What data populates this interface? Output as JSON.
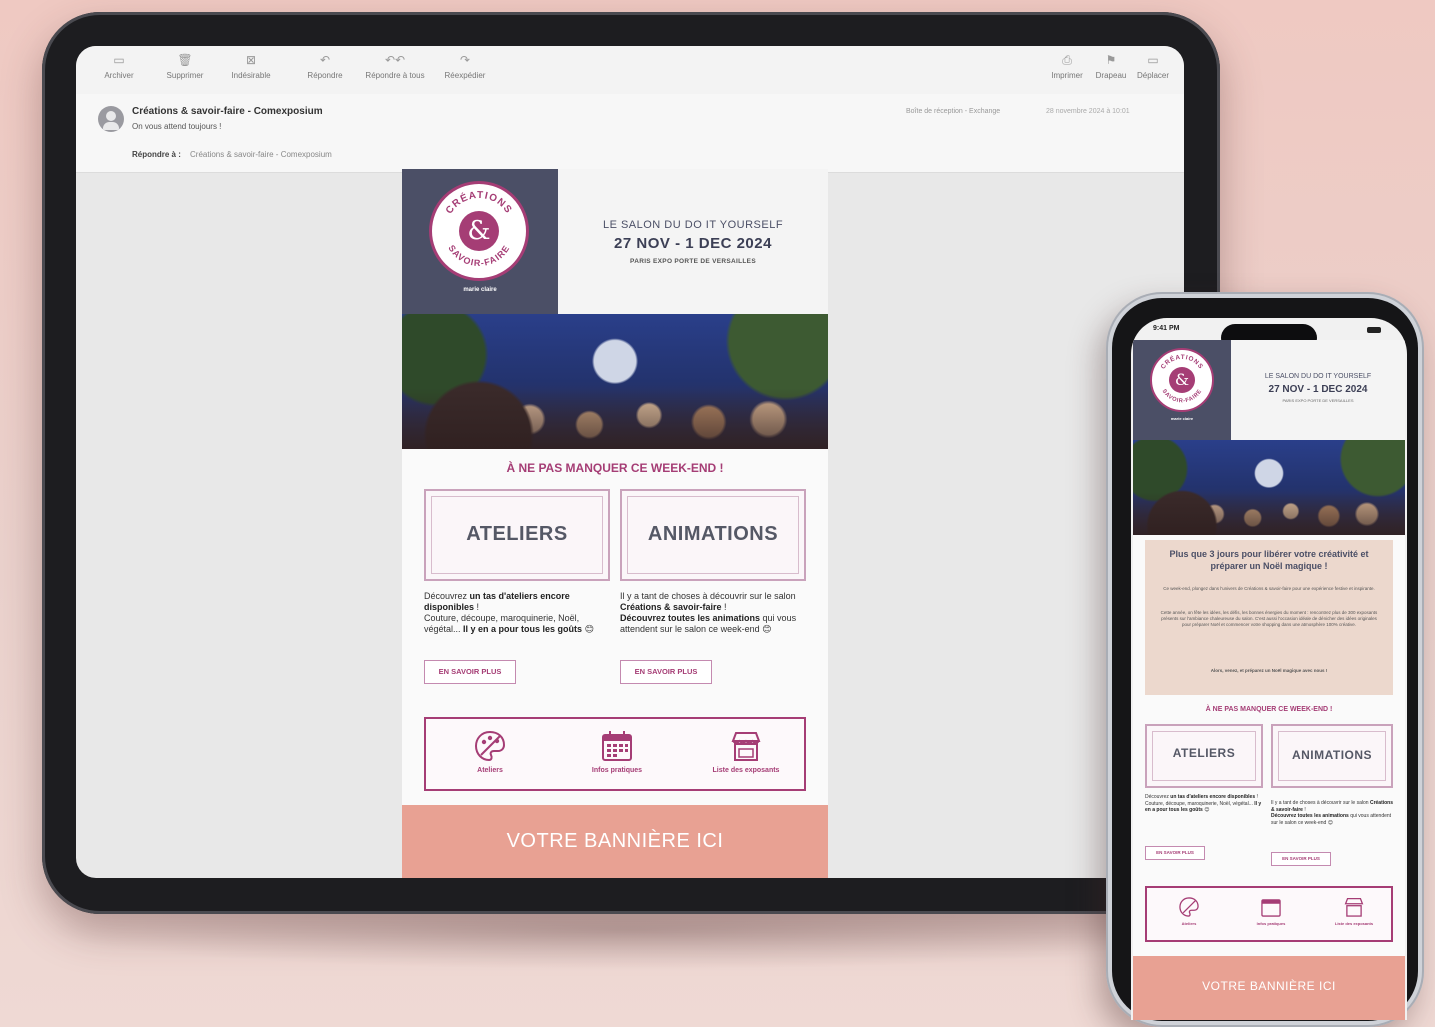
{
  "mail": {
    "toolbar": {
      "left": [
        {
          "label": "Archiver",
          "icon": "archive-icon",
          "glyph": "▭"
        },
        {
          "label": "Supprimer",
          "icon": "trash-icon",
          "glyph": "🗑"
        },
        {
          "label": "Indésirable",
          "icon": "junk-icon",
          "glyph": "⊠"
        },
        {
          "label": "Répondre",
          "icon": "reply-icon",
          "glyph": "↶"
        },
        {
          "label": "Répondre à tous",
          "icon": "reply-all-icon",
          "glyph": "↶↶"
        },
        {
          "label": "Réexpédier",
          "icon": "forward-icon",
          "glyph": "↷"
        }
      ],
      "right": [
        {
          "label": "Imprimer",
          "icon": "print-icon",
          "glyph": "⎙"
        },
        {
          "label": "Drapeau",
          "icon": "flag-icon",
          "glyph": "⚑"
        },
        {
          "label": "Déplacer",
          "icon": "move-icon",
          "glyph": "▭"
        }
      ]
    },
    "sender": "Créations & savoir-faire - Comexposium",
    "subject": "On vous attend toujours !",
    "reply_to_label": "Répondre à :",
    "reply_to_value": "Créations & savoir-faire - Comexposium",
    "folder": "Boîte de réception - Exchange",
    "date": "28 novembre 2024 à 10:01"
  },
  "newsletter": {
    "logo": {
      "top": "CRÉATIONS",
      "bottom": "SAVOIR-FAIRE",
      "center": "&",
      "tag": "marie claire"
    },
    "salon": "LE SALON DU DO IT YOURSELF",
    "dates": "27 NOV - 1 DEC 2024",
    "venue": "PARIS EXPO PORTE DE VERSAILLES",
    "headline": "À NE PAS MANQUER CE WEEK-END !",
    "cards": [
      {
        "title": "ATELIERS",
        "text_1": "Découvrez ",
        "bold_1": "un tas d'ateliers encore disponibles",
        "text_2": " !\nCouture, découpe, maroquinerie, Noël, végétal... ",
        "bold_2": "Il y en a pour tous les goûts",
        "emoji": "😊",
        "button": "EN SAVOIR PLUS"
      },
      {
        "title": "ANIMATIONS",
        "text_1": "Il y a tant de choses à découvrir sur le salon ",
        "bold_1": "Créations & savoir-faire",
        "text_2": " !\n",
        "bold_2": "Découvrez toutes les animations",
        "text_3": " qui vous attendent sur le salon ce week-end",
        "emoji": "😊",
        "button": "EN SAVOIR PLUS"
      }
    ],
    "quicklinks": [
      {
        "label": "Ateliers",
        "icon": "palette-icon"
      },
      {
        "label": "Infos pratiques",
        "icon": "calendar-icon"
      },
      {
        "label": "Liste des exposants",
        "icon": "store-icon"
      }
    ],
    "banner": "VOTRE BANNIÈRE ICI"
  },
  "phone": {
    "time": "9:41 PM",
    "intro_title": "Plus que 3 jours pour libérer votre créativité et préparer un Noël magique !",
    "intro_paragraphs": [
      "Ce week-end, plongez dans l'univers de Créations & savoir-faire pour une expérience festive et inspirante.",
      "Cette année, on fête les idées, les défis, les bonnes énergies du moment : rencontrez plus de 300 exposants présents sur l'ambiance chaleureuse du salon. C'est aussi l'occasion idéale de dénicher des idées originales pour préparer Noël et commencer votre shopping dans une atmosphère 100% créative.",
      "Alors, venez, et préparez un Noël magique avec nous !"
    ]
  },
  "colors": {
    "brand": "#a53d75",
    "navy": "#4b4f66",
    "banner": "#e8a193",
    "beige": "#ecd8cd",
    "background": "#efc9c2"
  }
}
